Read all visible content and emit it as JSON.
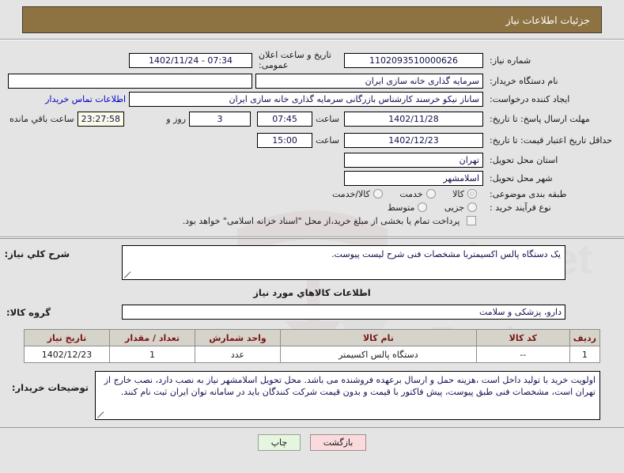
{
  "header": {
    "title": "جزئیات اطلاعات نیاز"
  },
  "form": {
    "need_number_label": "شماره نیاز:",
    "need_number_value": "1102093510000626",
    "announce_label": "تاریخ و ساعت اعلان عمومی:",
    "announce_value": "1402/11/24 - 07:34",
    "buyer_org_label": "نام دستگاه خریدار:",
    "buyer_org_value": "سرمایه گذاری خانه سازی ایران",
    "buyer_org_extra_value": "",
    "creator_label": "ایجاد کننده درخواست:",
    "creator_value": "ساناز نیکو خرسند کارشناس بازرگانی سرمایه گذاری خانه سازی ایران",
    "contact_link": "اطلاعات تماس خریدار",
    "deadline_label": "مهلت ارسال پاسخ: تا تاریخ:",
    "deadline_date": "1402/11/28",
    "deadline_time_label": "ساعت",
    "deadline_time": "07:45",
    "remaining_days": "3",
    "remaining_days_label": "روز و",
    "remaining_clock": "23:27:58",
    "remaining_suffix": "ساعت باقي مانده",
    "min_valid_label": "حداقل تاریخ اعتبار قیمت: تا تاریخ:",
    "min_valid_date": "1402/12/23",
    "min_valid_time_label": "ساعت",
    "min_valid_time": "15:00",
    "province_label": "استان محل تحویل:",
    "province_value": "تهران",
    "city_label": "شهر محل تحویل:",
    "city_value": "اسلامشهر",
    "category_label": "طبقه بندی موضوعی:",
    "category_options": [
      "کالا",
      "خدمت",
      "کالا/خدمت"
    ],
    "category_selected": "کالا",
    "process_label": "نوع فرآیند خرید :",
    "process_options": [
      "جزیی",
      "متوسط"
    ],
    "process_selected": "",
    "treasury_checkbox_label": "پرداخت تمام یا بخشی از مبلغ خرید،از محل \"اسناد خزانه اسلامی\" خواهد بود.",
    "treasury_checked": false
  },
  "description": {
    "label": "شرح كلي نياز:",
    "value": "یک دستگاه پالس اکسیمتربا مشخصات فنی شرح لیست پیوست."
  },
  "goods_section": {
    "title": "اطلاعات كالاهاي مورد نياز",
    "group_label": "گروه کالا:",
    "group_value": "دارو، پزشکی و سلامت"
  },
  "items_table": {
    "columns": [
      "ردیف",
      "کد کالا",
      "نام کالا",
      "واحد شمارش",
      "تعداد / مقدار",
      "تاریخ نیاز"
    ],
    "rows": [
      {
        "row_no": "1",
        "code": "--",
        "name": "دستگاه پالس اکسیمتر",
        "unit": "عدد",
        "quantity": "1",
        "need_date": "1402/12/23"
      }
    ]
  },
  "notes": {
    "label": "توضیحات خریدار:",
    "value": "اولویت خرید با تولید داخل است ،هزینه حمل و ارسال برعهده فروشنده می باشد. محل تحویل اسلامشهر نیاز به نصب دارد، نصب خارج از تهران است، مشخصات فنی طبق پیوست، پیش فاکتور با قیمت و بدون قیمت شرکت کنندگان باید در سامانه توان ایران ثبت نام کنند."
  },
  "footer": {
    "back_label": "بازگشت",
    "print_label": "چاپ"
  },
  "colors": {
    "header_bg": "#8d7242",
    "page_bg": "#e4e4e4",
    "link": "#0000c8",
    "table_header_text": "#7a1414",
    "back_btn_bg": "#fadadd",
    "print_btn_bg": "#e6f5e0",
    "countdown_bg": "#fbfbe8"
  }
}
